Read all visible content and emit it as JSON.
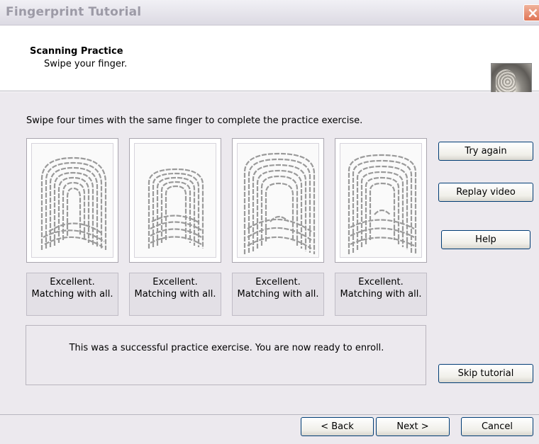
{
  "window": {
    "title": "Fingerprint Tutorial"
  },
  "header": {
    "title": "Scanning Practice",
    "subtitle": "Swipe your finger."
  },
  "content": {
    "instruction": "Swipe four times with the same finger to complete the practice exercise.",
    "scans": [
      {
        "status_line1": "Excellent.",
        "status_line2": "Matching with all."
      },
      {
        "status_line1": "Excellent.",
        "status_line2": "Matching with all."
      },
      {
        "status_line1": "Excellent.",
        "status_line2": "Matching with all."
      },
      {
        "status_line1": "Excellent.",
        "status_line2": "Matching with all."
      }
    ],
    "message": "This was a successful practice exercise. You are now ready to enroll."
  },
  "side_buttons": {
    "try_again": "Try again",
    "replay_video": "Replay video",
    "help": "Help",
    "skip_tutorial": "Skip tutorial"
  },
  "footer_buttons": {
    "back": "< Back",
    "next": "Next >",
    "cancel": "Cancel"
  },
  "icons": {
    "close": "close-icon",
    "header_image": "finger-photo-icon",
    "fingerprint": "fingerprint-icon"
  },
  "colors": {
    "accent_border": "#003c74",
    "close_red": "#e07454",
    "panel_bg": "#ece9ee"
  }
}
